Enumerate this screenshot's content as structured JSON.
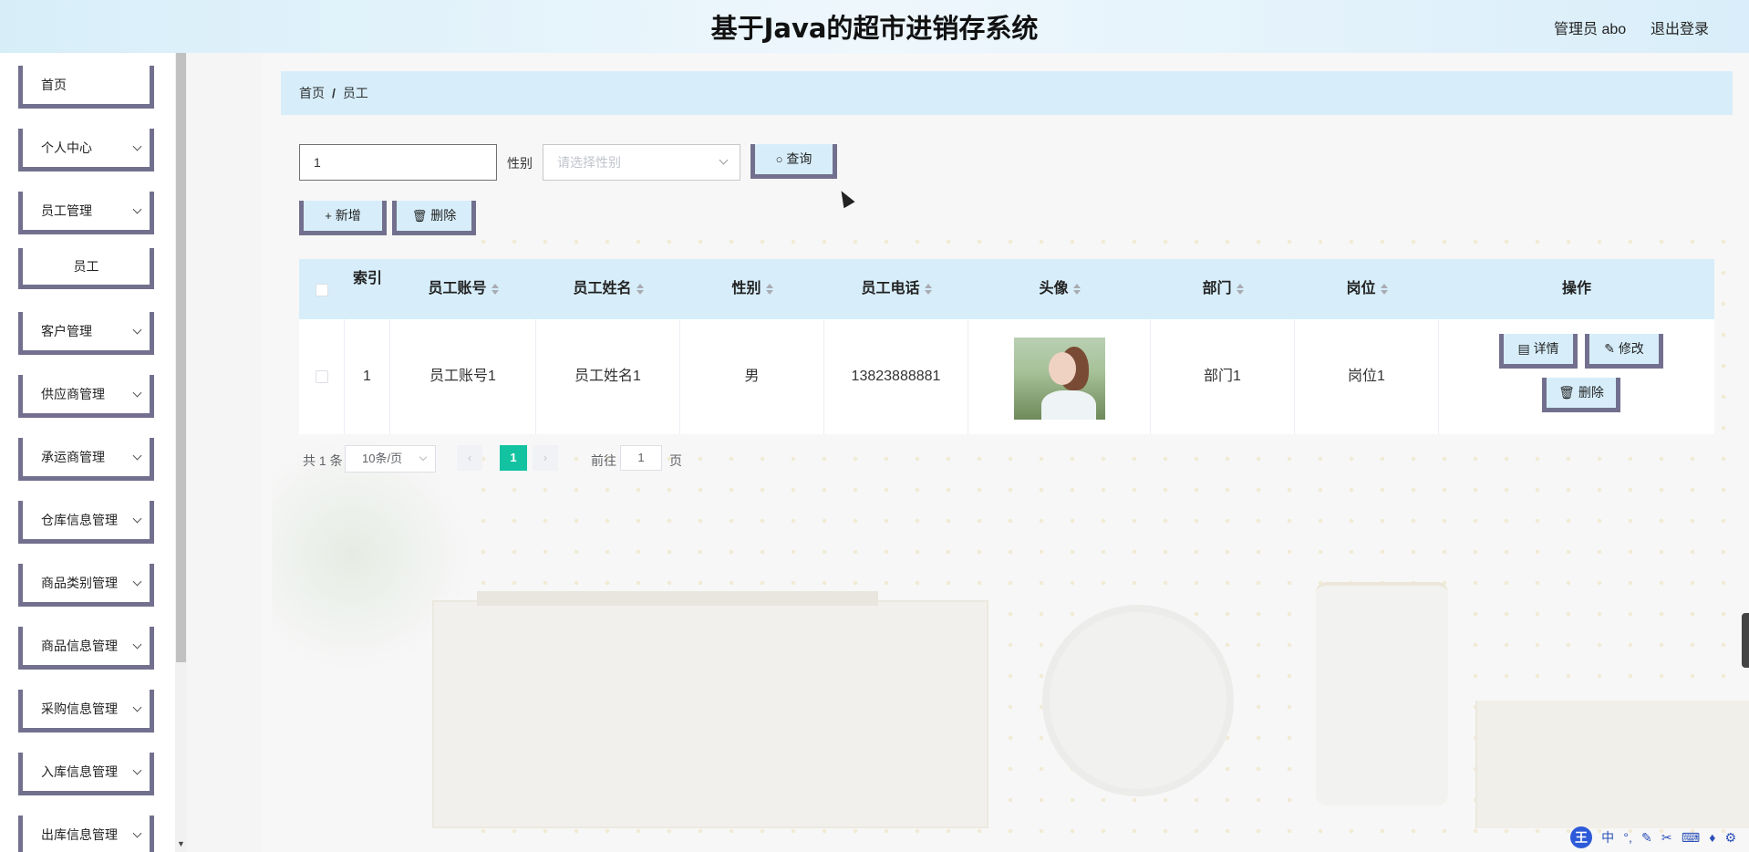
{
  "header": {
    "title": "基于Java的超市进销存系统",
    "user": "管理员 abo",
    "logout": "退出登录"
  },
  "sidebar": {
    "items": [
      {
        "label": "首页"
      },
      {
        "label": "个人中心"
      },
      {
        "label": "员工管理"
      },
      {
        "label": "员工"
      },
      {
        "label": "客户管理"
      },
      {
        "label": "供应商管理"
      },
      {
        "label": "承运商管理"
      },
      {
        "label": "仓库信息管理"
      },
      {
        "label": "商品类别管理"
      },
      {
        "label": "商品信息管理"
      },
      {
        "label": "采购信息管理"
      },
      {
        "label": "入库信息管理"
      },
      {
        "label": "出库信息管理"
      }
    ]
  },
  "breadcrumb": {
    "home": "首页",
    "separator": "/",
    "current": "员工"
  },
  "search": {
    "input_value": "1",
    "gender_label": "性别",
    "gender_placeholder": "请选择性别",
    "query_label": "查询",
    "add_label": "新增",
    "delete_label": "删除"
  },
  "table": {
    "columns": [
      "索引",
      "员工账号",
      "员工姓名",
      "性别",
      "员工电话",
      "头像",
      "部门",
      "岗位",
      "操作"
    ],
    "rows": [
      {
        "index": "1",
        "account": "员工账号1",
        "name": "员工姓名1",
        "gender": "男",
        "phone": "13823888881",
        "department": "部门1",
        "position": "岗位1",
        "actions": {
          "detail": "详情",
          "edit": "修改",
          "delete": "删除"
        }
      }
    ]
  },
  "pagination": {
    "total": "共 1 条",
    "page_size": "10条/页",
    "current_page": "1",
    "goto_label": "前往",
    "goto_value": "1",
    "page_suffix": "页"
  },
  "ime": {
    "logo": "王",
    "mode": "中"
  },
  "colors": {
    "accent": "#d7eefa",
    "border": "#72708e",
    "pager_active": "#13c2a0"
  }
}
